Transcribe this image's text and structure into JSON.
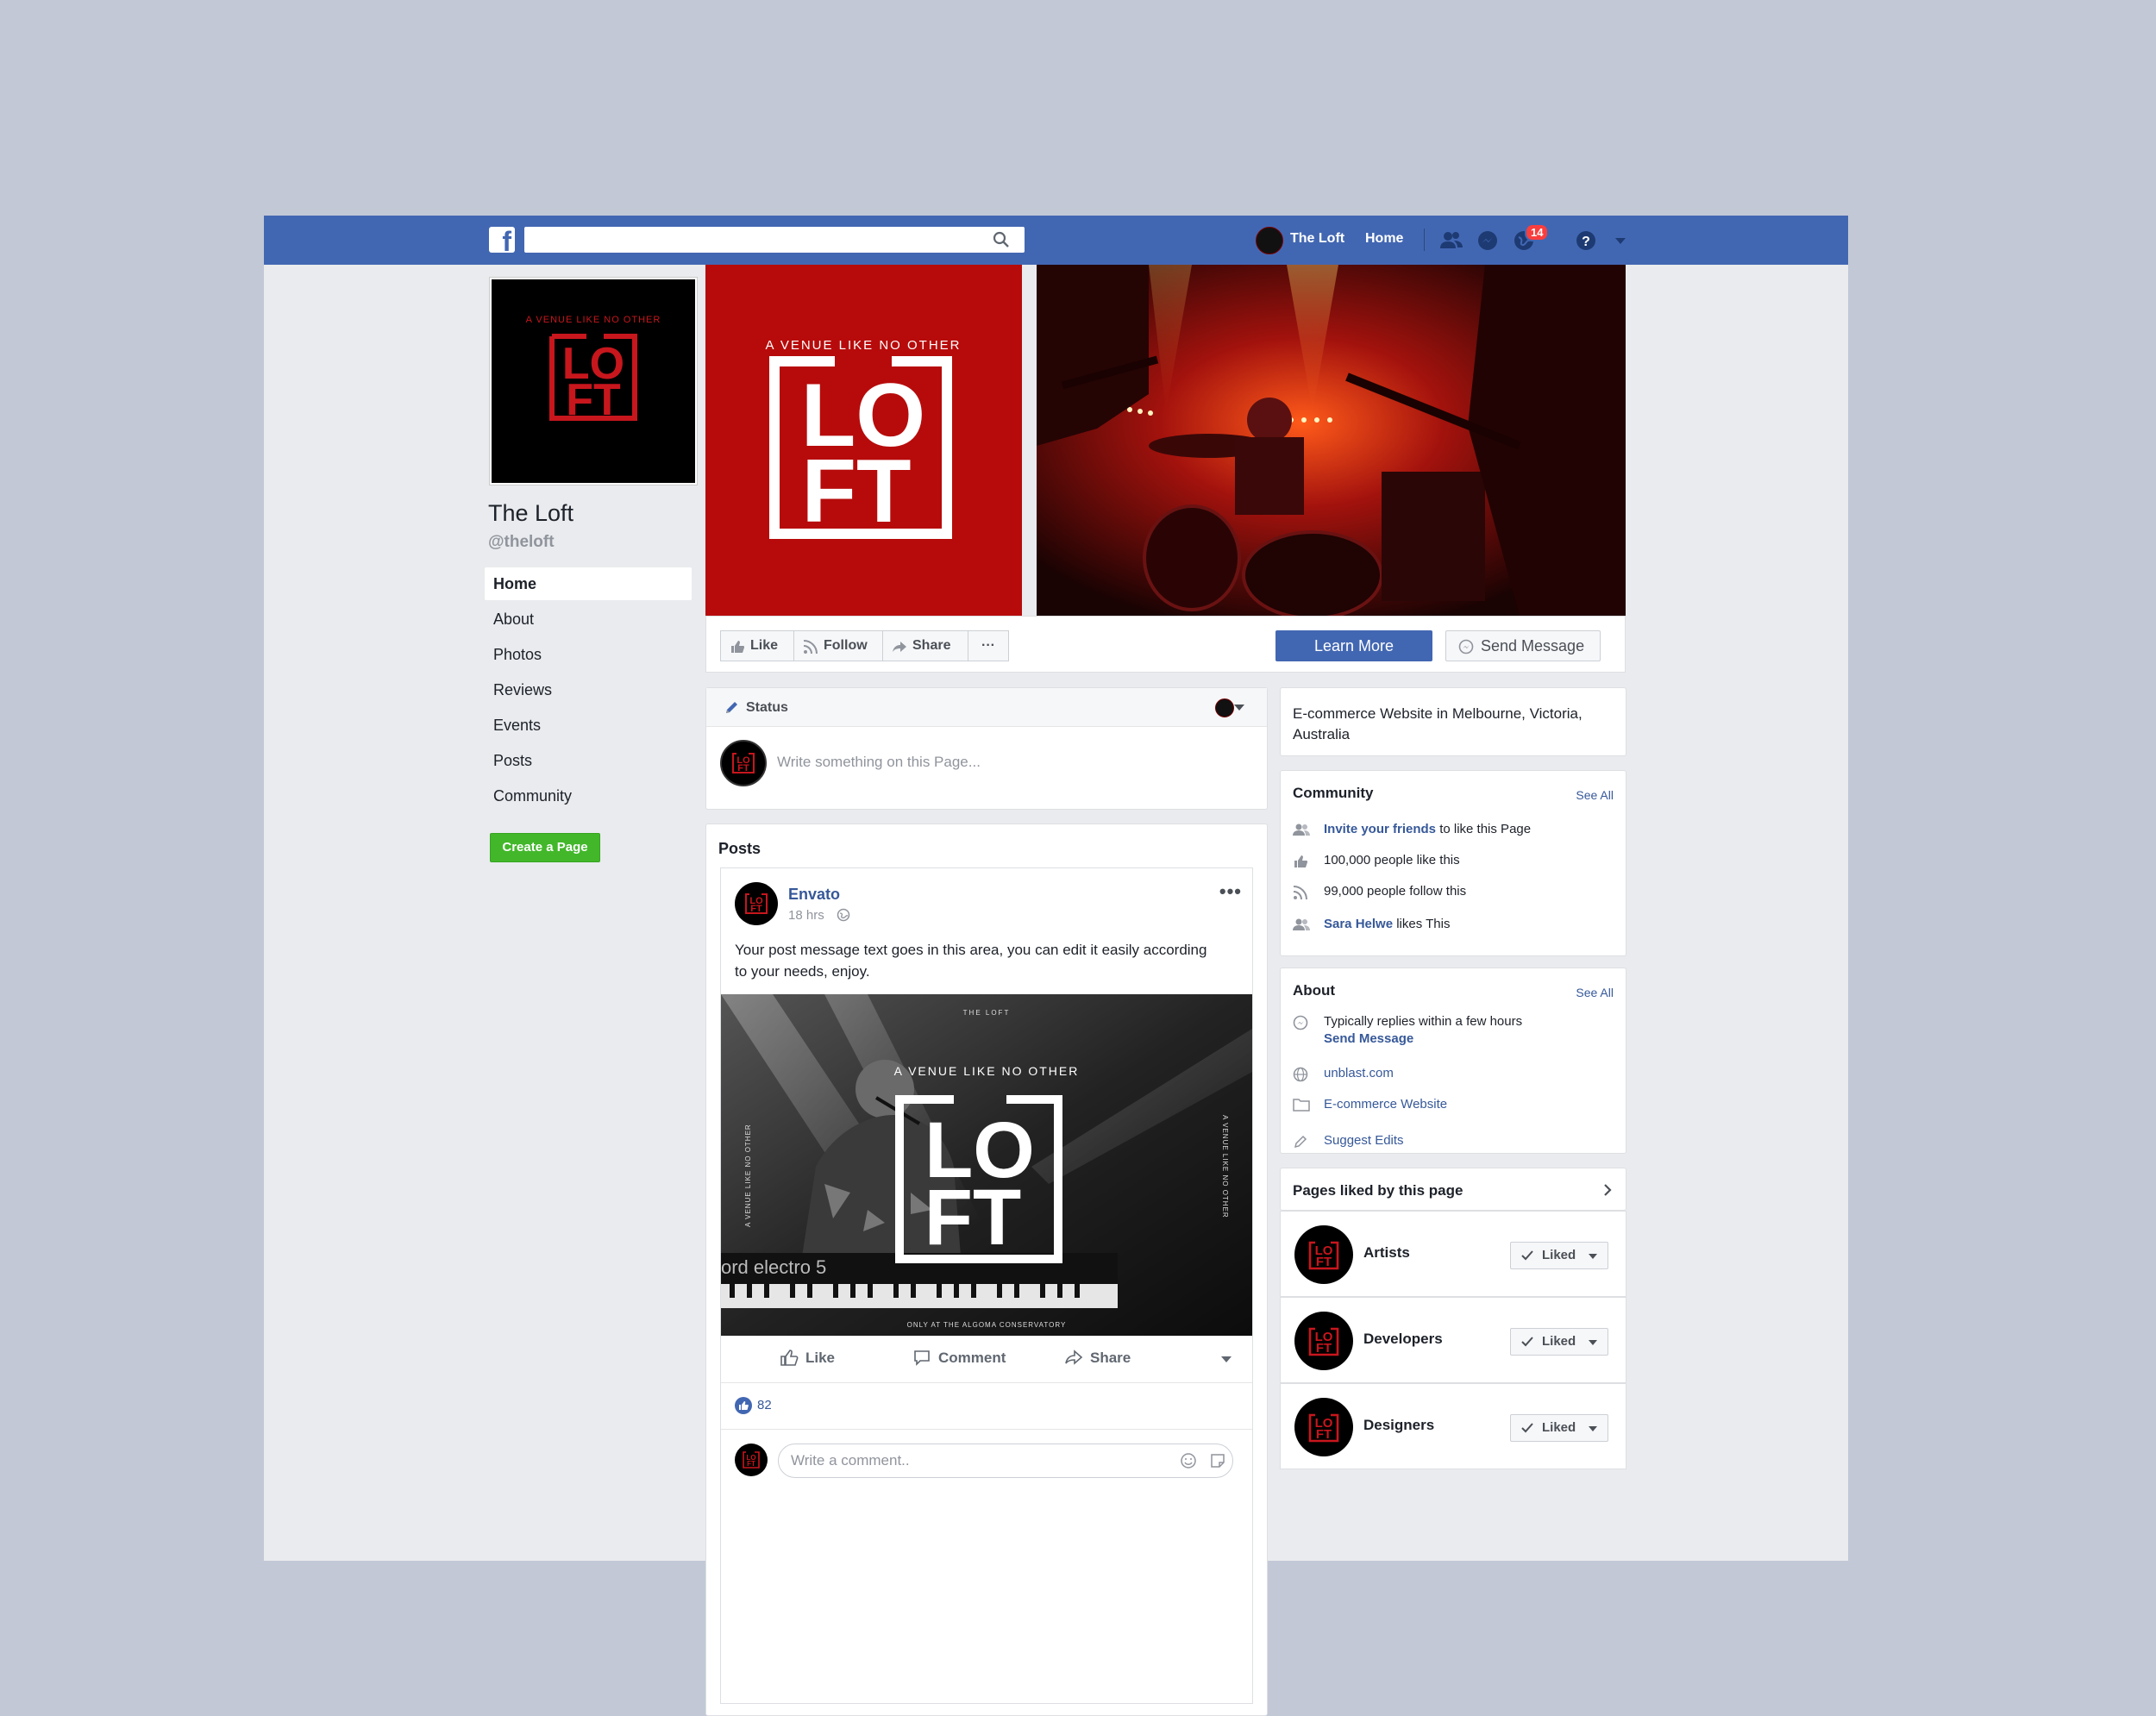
{
  "topbar": {
    "logo_letter": "f",
    "search_placeholder": "",
    "page_name": "The Loft",
    "home_label": "Home",
    "notification_count": "14"
  },
  "profile": {
    "name": "The Loft",
    "handle": "@theloft",
    "logo_tagline": "A VENUE LIKE NO OTHER",
    "logo_word": "LOFT"
  },
  "nav": {
    "items": [
      "Home",
      "About",
      "Photos",
      "Reviews",
      "Events",
      "Posts",
      "Community"
    ],
    "create_page": "Create a Page"
  },
  "cover": {
    "tagline": "A VENUE LIKE NO OTHER",
    "logo_word": "LOFT"
  },
  "actions": {
    "like": "Like",
    "follow": "Follow",
    "share": "Share",
    "more": "···",
    "learn_more": "Learn More",
    "send_message": "Send Message"
  },
  "status": {
    "label": "Status",
    "placeholder": "Write something on this Page..."
  },
  "posts": {
    "title": "Posts",
    "post": {
      "author": "Envato",
      "time": "18 hrs",
      "text": "Your post message text goes in this area, you can edit it easily according to your needs, enjoy.",
      "image_top": "THE LOFT",
      "image_tagline": "A VENUE LIKE NO OTHER",
      "image_side": "A VENUE LIKE NO OTHER",
      "image_bottom": "ONLY AT THE ALGOMA CONSERVATORY",
      "image_keyboard": "ord electro 5",
      "like_label": "Like",
      "comment_label": "Comment",
      "share_label": "Share",
      "reaction_count": "82",
      "comment_placeholder": "Write a comment.."
    }
  },
  "description": "E-commerce Website in Melbourne, Victoria, Australia",
  "community": {
    "title": "Community",
    "see_all": "See All",
    "invite_link": "Invite your friends",
    "invite_rest": " to like this Page",
    "likes": "100,000 people like this",
    "follows": "99,000 people follow this",
    "friend_name": "Sara Helwe",
    "friend_rest": " likes This"
  },
  "about": {
    "title": "About",
    "see_all": "See All",
    "replies": "Typically replies within a few hours",
    "send_message": "Send Message",
    "website": "unblast.com",
    "category": "E-commerce Website",
    "suggest": "Suggest Edits"
  },
  "liked_pages": {
    "title": "Pages liked by this page",
    "liked_label": "Liked",
    "pages": [
      "Artists",
      "Developers",
      "Designers"
    ]
  },
  "colors": {
    "fb_blue": "#4267b2",
    "loft_red": "#b70b0b",
    "link": "#365899",
    "green": "#42b72a"
  }
}
